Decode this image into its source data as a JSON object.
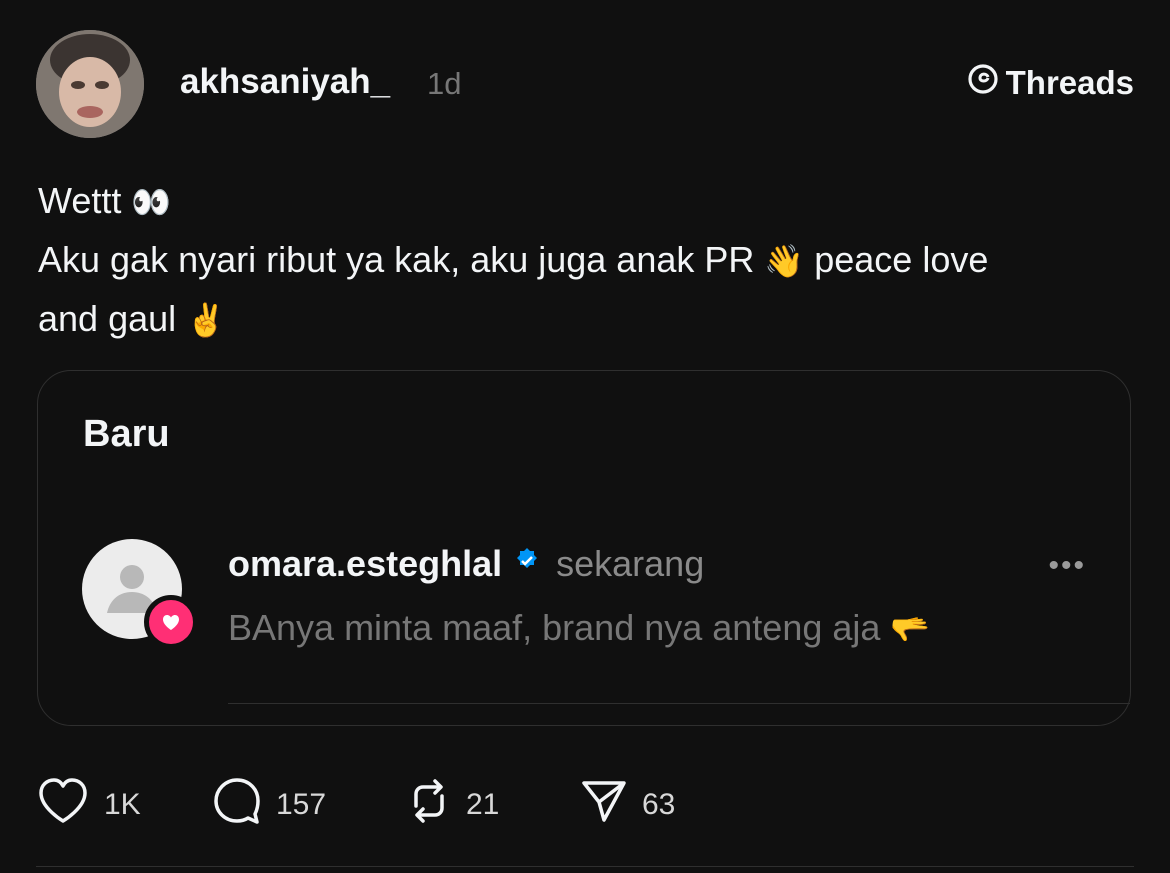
{
  "post": {
    "username": "akhsaniyah_",
    "time": "1d",
    "brand": "Threads",
    "text_lines": [
      [
        "Wettt ",
        "👀"
      ],
      [
        "Aku gak nyari ribut ya kak, aku juga anak PR ",
        "👋",
        " peace love"
      ],
      [
        "and gaul ",
        "✌️"
      ]
    ]
  },
  "card": {
    "title": "Baru",
    "notification": {
      "username": "omara.esteghlal",
      "verified": true,
      "time": "sekarang",
      "text": "BAnya minta maaf, brand nya anteng aja ",
      "emoji": "🫳"
    }
  },
  "actions": {
    "likes": "1K",
    "comments": "157",
    "reposts": "21",
    "shares": "63"
  },
  "colors": {
    "background": "#101010",
    "text": "#f3f5f7",
    "muted": "#777777",
    "verified": "#0095f6",
    "heart_badge": "#ff2f75"
  },
  "icons": [
    "threads-logo-icon",
    "heart-icon",
    "comment-icon",
    "repost-icon",
    "share-icon",
    "verified-badge-icon",
    "more-icon"
  ]
}
